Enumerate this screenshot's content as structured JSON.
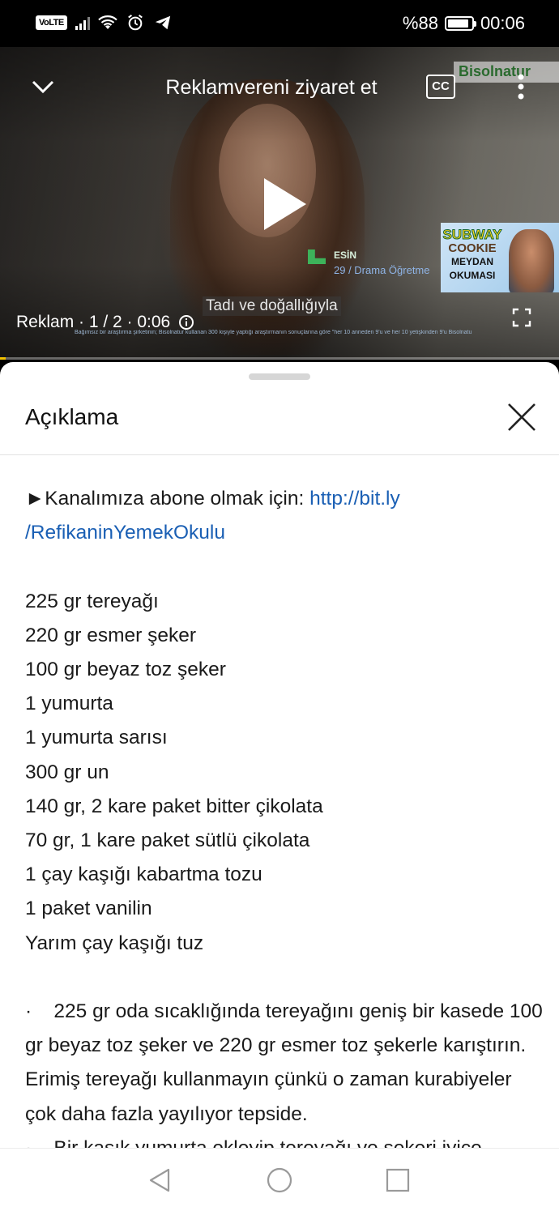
{
  "status_bar": {
    "volte": "VoLTE",
    "battery_text": "%88",
    "battery_level": 0.88,
    "time": "00:06",
    "icons": [
      "signal-icon",
      "wifi-icon",
      "alarm-icon",
      "telegram-icon",
      "battery-icon"
    ]
  },
  "player": {
    "title": "Reklamvereni ziyaret et",
    "cc_label": "CC",
    "brand": "Bisolnatur",
    "subtitle": "Tadı ve doğallığıyla",
    "ad_info": "Reklam · 1 / 2 · 0:06",
    "name_tag_name": "ESİN",
    "name_tag_role": "29 / Drama Öğretme",
    "disclaimer": "Bağımsız bir araştırma şirketinin; Bisolnatur kullanan 300 kişiyle yaptığı araştırmanın sonuçlarına göre \"her 10 anneden 9'u ve her 10 yetişkinden 9'u Bisolnatu",
    "thumbnail": {
      "line1": "SUBWAY",
      "line2": "COOKIE",
      "line3": "MEYDAN OKUMASI"
    },
    "progress": 0.01,
    "icons": [
      "chevron-down-icon",
      "cc-icon",
      "more-vert-icon",
      "play-icon",
      "info-icon",
      "fullscreen-icon"
    ]
  },
  "sheet": {
    "title": "Açıklama",
    "subscribe_prefix": "►Kanalımıza abone olmak için: ",
    "subscribe_link_1": "http://bit.ly",
    "subscribe_link_2": "/RefikaninYemekOkulu",
    "ingredients": [
      "225 gr tereyağı",
      "220 gr esmer şeker",
      "100 gr beyaz toz şeker",
      "1 yumurta",
      "1 yumurta sarısı",
      "300 gr un",
      "140 gr, 2 kare paket bitter çikolata",
      "70 gr, 1 kare paket sütlü çikolata",
      "1 çay kaşığı kabartma tozu",
      "1 paket vanilin",
      "Yarım çay kaşığı tuz"
    ],
    "step_1": "·    225 gr oda sıcaklığında tereyağını geniş bir kasede 100 gr beyaz toz şeker ve 220 gr esmer toz şekerle karıştırın. Erimiş tereyağı kullanmayın çünkü o zaman kurabiyeler çok daha fazla yayılıyor tepside.",
    "step_2_partial": "·    Bir kaşık yumurta ekleyip tereyağı ve şekeri iyice"
  },
  "navbar": {
    "icons": [
      "back-icon",
      "home-icon",
      "recents-icon"
    ]
  }
}
